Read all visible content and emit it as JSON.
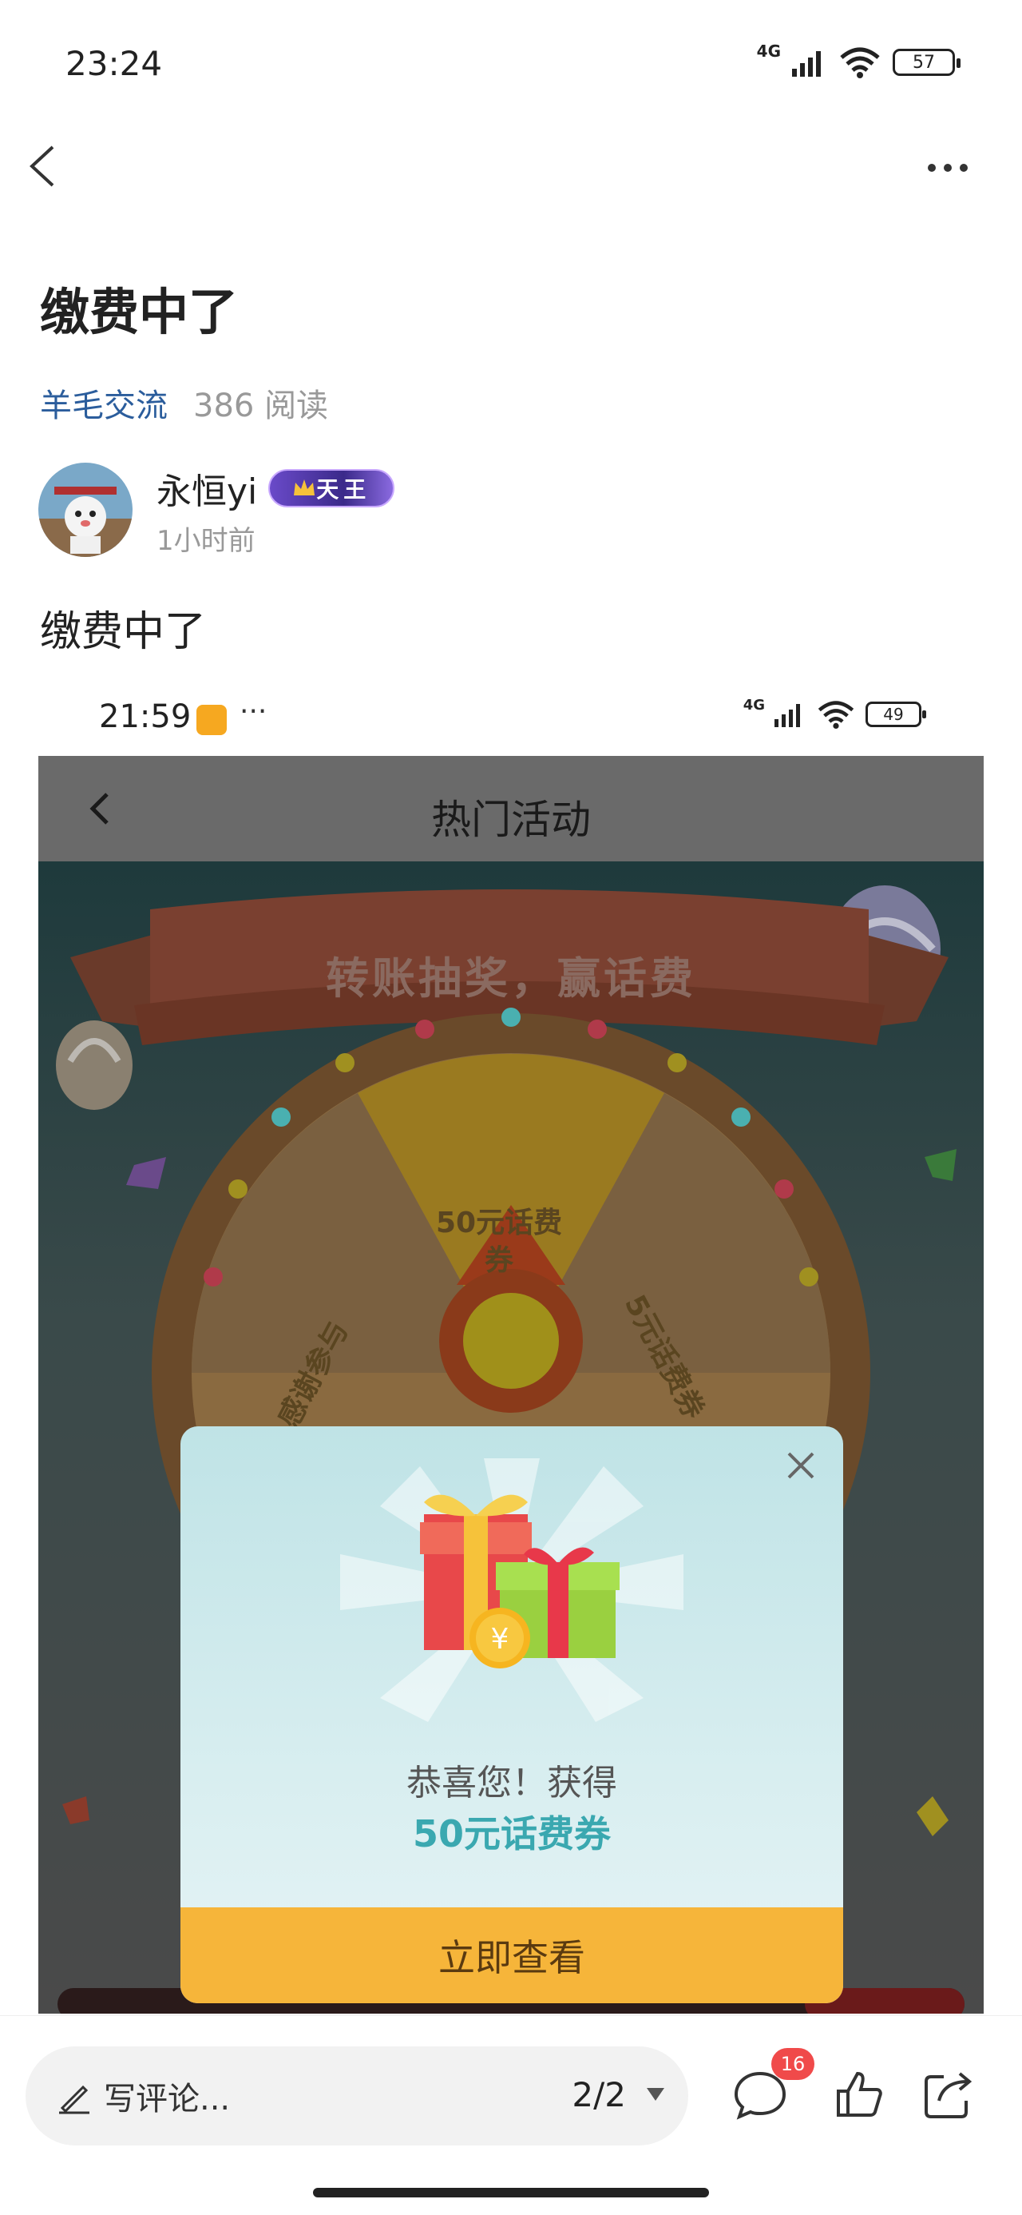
{
  "status_bar": {
    "time": "23:24",
    "network": "4G",
    "battery": "57"
  },
  "post": {
    "title": "缴费中了",
    "channel": "羊毛交流",
    "reads": "386 阅读",
    "author_name": "永恒yi",
    "author_badge": "天王",
    "time": "1小时前",
    "body": "缴费中了"
  },
  "embedded_screenshot": {
    "status_time": "21:59",
    "status_dots": "···",
    "network": "4G",
    "battery": "49",
    "header_title": "热门活动",
    "banner": "转账抽奖，赢话费",
    "wheel_segments": [
      "50元话费\n券",
      "5元话费券",
      "感谢参与"
    ],
    "modal": {
      "line1": "恭喜您！获得",
      "line2": "50元话费券",
      "button": "立即查看"
    }
  },
  "bottom_bar": {
    "comment_placeholder": "写评论...",
    "page_indicator": "2/2",
    "comment_count": "16"
  },
  "colors": {
    "channel_link": "#2b5d9c",
    "modal_button": "#f6b53a",
    "modal_highlight": "#3aa8b0",
    "badge_red": "#f04a4a"
  }
}
